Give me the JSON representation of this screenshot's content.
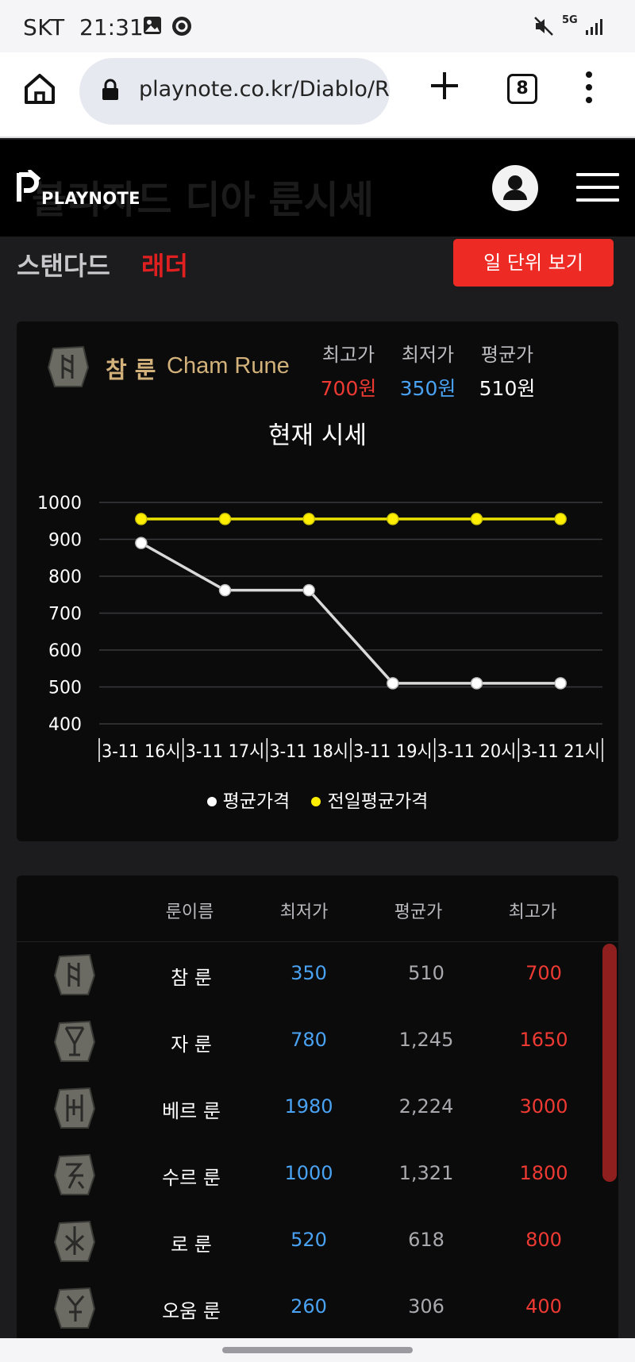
{
  "status_bar": {
    "carrier": "SKT",
    "time": "21:31",
    "network": "5G"
  },
  "browser": {
    "url": "playnote.co.kr/Diablo/Ru",
    "tab_count": "8"
  },
  "site": {
    "logo_text": "PLAYNOTE",
    "ghost_title": "블리자드 디아 룬시세"
  },
  "mode": {
    "standard": "스탠다드",
    "ladder": "래더",
    "daily_button": "일 단위 보기"
  },
  "rune_card": {
    "name_ko": "참 룬",
    "name_en": "Cham Rune",
    "max_label": "최고가",
    "max_value": "700원",
    "min_label": "최저가",
    "min_value": "350원",
    "avg_label": "평균가",
    "avg_value": "510원"
  },
  "chart_data": {
    "type": "line",
    "title": "현재 시세",
    "categories": [
      "3-11 16시",
      "3-11 17시",
      "3-11 18시",
      "3-11 19시",
      "3-11 20시",
      "3-11 21시"
    ],
    "series": [
      {
        "name": "평균가격",
        "values": [
          890,
          762,
          762,
          510,
          510,
          510
        ],
        "color": "#ffffff"
      },
      {
        "name": "전일평균가격",
        "values": [
          955,
          955,
          955,
          955,
          955,
          955
        ],
        "color": "#ffee00"
      }
    ],
    "yticks": [
      1000,
      900,
      800,
      700,
      600,
      500,
      400
    ],
    "ylim": [
      400,
      1000
    ],
    "grid": true,
    "legend": "bottom-center"
  },
  "table": {
    "headers": {
      "name": "룬이름",
      "min": "최저가",
      "avg": "평균가",
      "max": "최고가"
    },
    "rows": [
      {
        "name": "참 룬",
        "min": "350",
        "avg": "510",
        "max": "700"
      },
      {
        "name": "자 룬",
        "min": "780",
        "avg": "1,245",
        "max": "1650"
      },
      {
        "name": "베르 룬",
        "min": "1980",
        "avg": "2,224",
        "max": "3000"
      },
      {
        "name": "수르 룬",
        "min": "1000",
        "avg": "1,321",
        "max": "1800"
      },
      {
        "name": "로 룬",
        "min": "520",
        "avg": "618",
        "max": "800"
      },
      {
        "name": "오움 룬",
        "min": "260",
        "avg": "306",
        "max": "400"
      }
    ]
  }
}
